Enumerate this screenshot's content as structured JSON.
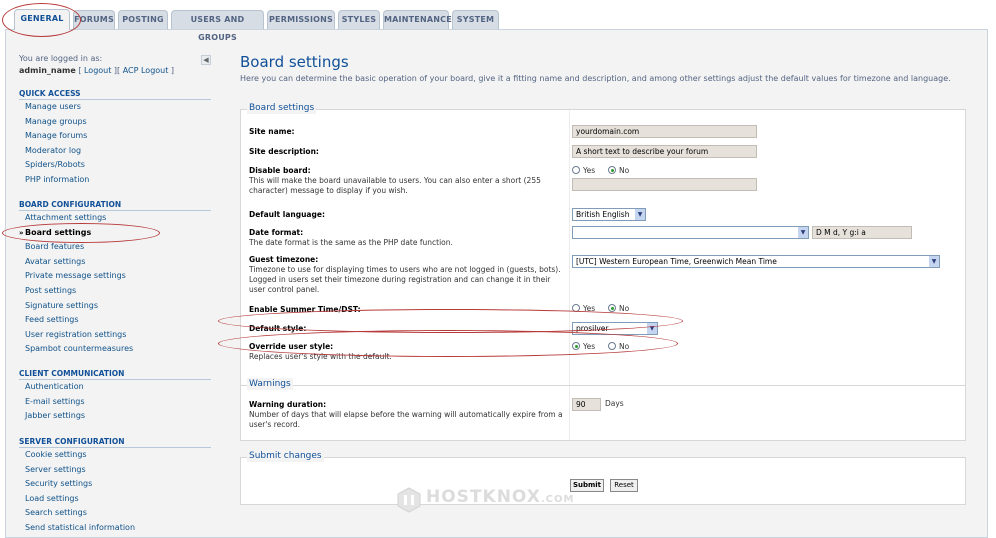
{
  "tabs": [
    "GENERAL",
    "FORUMS",
    "POSTING",
    "USERS AND GROUPS",
    "PERMISSIONS",
    "STYLES",
    "MAINTENANCE",
    "SYSTEM"
  ],
  "sidebar": {
    "logged_in_label": "You are logged in as:",
    "username": "admin_name",
    "logout_link": "Logout",
    "acp_logout_link": "ACP Logout",
    "sections": [
      {
        "title": "QUICK ACCESS",
        "items": [
          "Manage users",
          "Manage groups",
          "Manage forums",
          "Moderator log",
          "Spiders/Robots",
          "PHP information"
        ]
      },
      {
        "title": "BOARD CONFIGURATION",
        "items": [
          "Attachment settings",
          "Board settings",
          "Board features",
          "Avatar settings",
          "Private message settings",
          "Post settings",
          "Signature settings",
          "Feed settings",
          "User registration settings",
          "Spambot countermeasures"
        ]
      },
      {
        "title": "CLIENT COMMUNICATION",
        "items": [
          "Authentication",
          "E-mail settings",
          "Jabber settings"
        ]
      },
      {
        "title": "SERVER CONFIGURATION",
        "items": [
          "Cookie settings",
          "Server settings",
          "Security settings",
          "Load settings",
          "Search settings",
          "Send statistical information"
        ]
      }
    ],
    "active_item": "Board settings"
  },
  "main": {
    "title": "Board settings",
    "description": "Here you can determine the basic operation of your board, give it a fitting name and description, and among other settings adjust the default values for timezone and language.",
    "board_settings": {
      "legend": "Board settings",
      "site_name_label": "Site name:",
      "site_name_value": "yourdomain.com",
      "site_desc_label": "Site description:",
      "site_desc_value": "A short text to describe your forum",
      "disable_label": "Disable board:",
      "disable_explain": "This will make the board unavailable to users. You can also enter a short (255 character) message to display if you wish.",
      "disable_value": "No",
      "yes": "Yes",
      "no": "No",
      "language_label": "Default language:",
      "language_value": "British English",
      "date_label": "Date format:",
      "date_explain": "The date format is the same as the PHP date function.",
      "date_value": "D M d, Y g:i a",
      "tz_label": "Guest timezone:",
      "tz_explain": "Timezone to use for displaying times to users who are not logged in (guests, bots). Logged in users set their timezone during registration and can change it in their user control panel.",
      "tz_value": "[UTC] Western European Time, Greenwich Mean Time",
      "dst_label": "Enable Summer Time/DST:",
      "dst_value": "No",
      "style_label": "Default style:",
      "style_value": "prosilver",
      "override_label": "Override user style:",
      "override_explain": "Replaces user's style with the default.",
      "override_value": "Yes"
    },
    "warnings": {
      "legend": "Warnings",
      "duration_label": "Warning duration:",
      "duration_explain": "Number of days that will elapse before the warning will automatically expire from a user's record.",
      "duration_value": "90",
      "duration_unit": "Days"
    },
    "submit": {
      "legend": "Submit changes",
      "submit_label": "Submit",
      "reset_label": "Reset"
    }
  },
  "watermark": {
    "text": "HOSTKNOX",
    "suffix": ".COM"
  },
  "colors": {
    "accent": "#115098",
    "link": "#105289",
    "annotation": "#b73a3a"
  }
}
